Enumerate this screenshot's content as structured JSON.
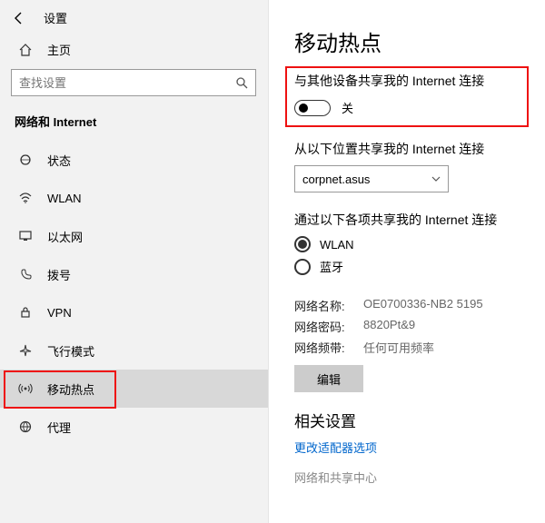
{
  "topbar": {
    "title": "设置"
  },
  "home": {
    "label": "主页"
  },
  "search": {
    "placeholder": "查找设置"
  },
  "section": {
    "header": "网络和 Internet"
  },
  "nav": [
    {
      "label": "状态"
    },
    {
      "label": "WLAN"
    },
    {
      "label": "以太网"
    },
    {
      "label": "拨号"
    },
    {
      "label": "VPN"
    },
    {
      "label": "飞行模式"
    },
    {
      "label": "移动热点"
    },
    {
      "label": "代理"
    }
  ],
  "page": {
    "title": "移动热点",
    "share_label": "与其他设备共享我的 Internet 连接",
    "toggle_state": "关",
    "share_from_label": "从以下位置共享我的 Internet 连接",
    "share_from_value": "corpnet.asus",
    "share_via_label": "通过以下各项共享我的 Internet 连接",
    "radio": {
      "wlan": "WLAN",
      "bluetooth": "蓝牙"
    },
    "net_name_k": "网络名称:",
    "net_name_v": "OE0700336-NB2 5195",
    "net_pwd_k": "网络密码:",
    "net_pwd_v": "8820Pt&9",
    "net_band_k": "网络频带:",
    "net_band_v": "任何可用频率",
    "edit_btn": "编辑",
    "related_header": "相关设置",
    "link_adapter": "更改适配器选项",
    "link_center": "网络和共享中心"
  }
}
